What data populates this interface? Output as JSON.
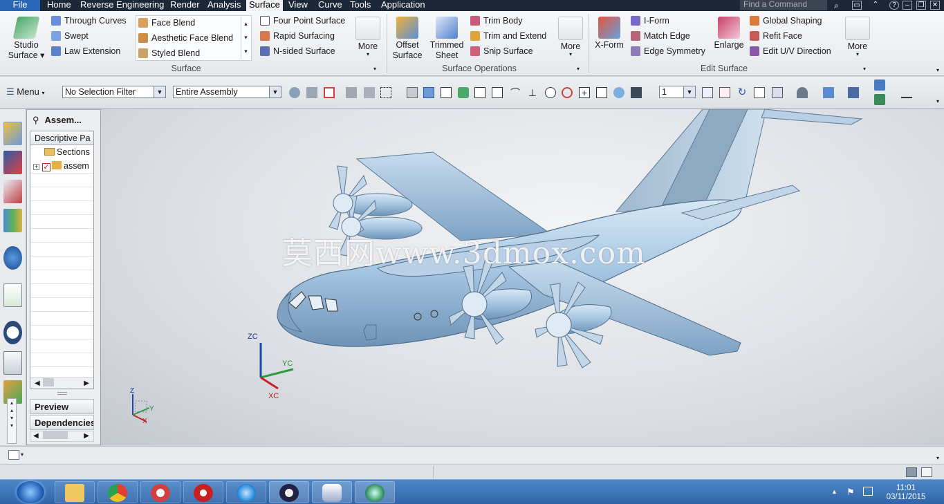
{
  "menubar": {
    "tabs": [
      "File",
      "Home",
      "Reverse Engineering",
      "Render",
      "Analysis",
      "Surface",
      "View",
      "Curve",
      "Tools",
      "Application"
    ],
    "active": "Surface",
    "search_placeholder": "Find a Command"
  },
  "ribbon": {
    "studio_surface": "Studio Surface ▾",
    "surface_col1": [
      "Through Curves",
      "Swept",
      "Law Extension"
    ],
    "surface_col2": [
      "Face Blend",
      "Aesthetic Face Blend",
      "Styled Blend"
    ],
    "surface_col3": [
      "Four Point Surface",
      "Rapid Surfacing",
      "N-sided Surface"
    ],
    "more": "More",
    "surface_group": "Surface",
    "offset_surface": "Offset Surface",
    "trimmed_sheet": "Trimmed Sheet",
    "ops_col": [
      "Trim Body",
      "Trim and Extend",
      "Snip Surface"
    ],
    "ops_group": "Surface Operations",
    "xform": "X-Form",
    "edit_col1": [
      "I-Form",
      "Match Edge",
      "Edge Symmetry"
    ],
    "enlarge": "Enlarge",
    "edit_col2": [
      "Global Shaping",
      "Refit Face",
      "Edit U/V Direction"
    ],
    "edit_group": "Edit Surface"
  },
  "toolbar": {
    "menu": "Menu",
    "selection_filter": "No Selection Filter",
    "scope": "Entire Assembly",
    "layer": "1"
  },
  "navigator": {
    "title": "Assem...",
    "column": "Descriptive Pa",
    "rows": [
      "Sections",
      "assem"
    ],
    "preview": "Preview",
    "dependencies": "Dependencies"
  },
  "viewport": {
    "watermark": "莫西网www.3dmox.com",
    "axes": [
      "ZC",
      "YC",
      "XC"
    ],
    "mini_axes": [
      "Z",
      "Y",
      "X"
    ]
  },
  "taskbar": {
    "time": "11:01",
    "date": "03/11/2015"
  },
  "colors": {
    "menubar": "#1b2838",
    "accent": "#2a66b8",
    "aircraft": "#a9c8e4",
    "taskbar": "#3a72b8"
  }
}
